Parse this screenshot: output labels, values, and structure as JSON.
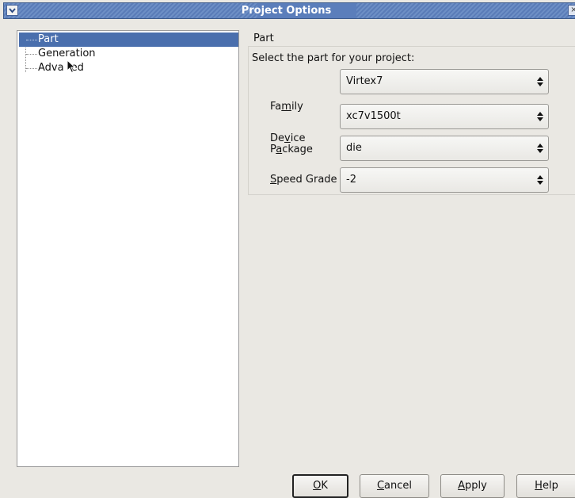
{
  "window": {
    "title": "Project Options"
  },
  "tree": {
    "items": [
      {
        "label": "Part",
        "selected": true
      },
      {
        "label": "Generation",
        "selected": false
      },
      {
        "label": "Adva",
        "label_tail": "ed",
        "selected": false
      }
    ]
  },
  "panel": {
    "section_title": "Part",
    "description": "Select the part for your project:",
    "fields": [
      {
        "label_pre": "Fa",
        "label_mn": "m",
        "label_post": "ily",
        "value": "Virtex7"
      },
      {
        "label_pre": "De",
        "label_mn": "v",
        "label_post": "ice",
        "value": "xc7v1500t"
      },
      {
        "label_pre": "P",
        "label_mn": "a",
        "label_post": "ckage",
        "value": "die"
      },
      {
        "label_pre": "",
        "label_mn": "S",
        "label_post": "peed Grade",
        "value": "-2"
      }
    ]
  },
  "buttons": {
    "ok": {
      "mn": "O",
      "rest": "K"
    },
    "cancel": {
      "mn": "C",
      "rest": "ancel"
    },
    "apply": {
      "mn": "A",
      "rest": "pply"
    },
    "help": {
      "mn": "H",
      "rest": "elp"
    }
  },
  "colors": {
    "titlebar": "#5b7ebb",
    "selection": "#4a6fad",
    "dialog_bg": "#eae8e3"
  },
  "icons": {
    "menu": "chevron-down-icon",
    "close": "close-icon",
    "combo": "up-down-arrows-icon",
    "cursor": "mouse-pointer-icon"
  }
}
